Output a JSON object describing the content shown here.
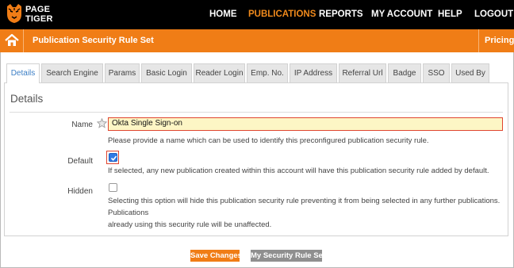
{
  "brand": {
    "line1": "PAGE",
    "line2": "TIGER"
  },
  "nav": {
    "items": [
      {
        "label": "HOME",
        "active": false
      },
      {
        "label": "PUBLICATIONS",
        "active": true
      },
      {
        "label": "REPORTS",
        "active": false
      },
      {
        "label": "MY ACCOUNT",
        "active": false
      },
      {
        "label": "HELP",
        "active": false
      },
      {
        "label": "LOGOUT",
        "active": false
      }
    ]
  },
  "subbar": {
    "title": "Publication Security Rule Set",
    "pricing_label": "Pricing"
  },
  "tabs": [
    {
      "label": "Details",
      "active": true
    },
    {
      "label": "Search Engine",
      "active": false
    },
    {
      "label": "Params",
      "active": false
    },
    {
      "label": "Basic Login",
      "active": false
    },
    {
      "label": "Reader Login",
      "active": false
    },
    {
      "label": "Emp. No.",
      "active": false
    },
    {
      "label": "IP Address",
      "active": false
    },
    {
      "label": "Referral Url",
      "active": false
    },
    {
      "label": "Badge",
      "active": false
    },
    {
      "label": "SSO",
      "active": false
    },
    {
      "label": "Used By",
      "active": false
    }
  ],
  "details": {
    "title": "Details",
    "name": {
      "label": "Name",
      "value": "Okta Single Sign-on",
      "help": "Please provide a name which can be used to identify this preconfigured publication security rule."
    },
    "default": {
      "label": "Default",
      "checked": true,
      "help": "If selected, any new publication created within this account will have this publication security rule added by default."
    },
    "hidden": {
      "label": "Hidden",
      "checked": false,
      "help_line1": "Selecting this option will hide this publication security rule preventing it from being selected in any further publications. Publications",
      "help_line2": "already using this security rule will be unaffected."
    }
  },
  "buttons": {
    "save_label": "Save Changes",
    "sets_label": "My Security Rule Sets"
  },
  "colors": {
    "accent": "#f07d16",
    "topbar": "#000000",
    "active_tab_text": "#3c7fc6",
    "highlight_border": "#e0452f",
    "input_fill": "#fdf6c5"
  },
  "icons": {
    "home": "home-icon",
    "star": "star-icon",
    "check": "checkmark-icon",
    "logo": "tiger-logo-icon"
  }
}
